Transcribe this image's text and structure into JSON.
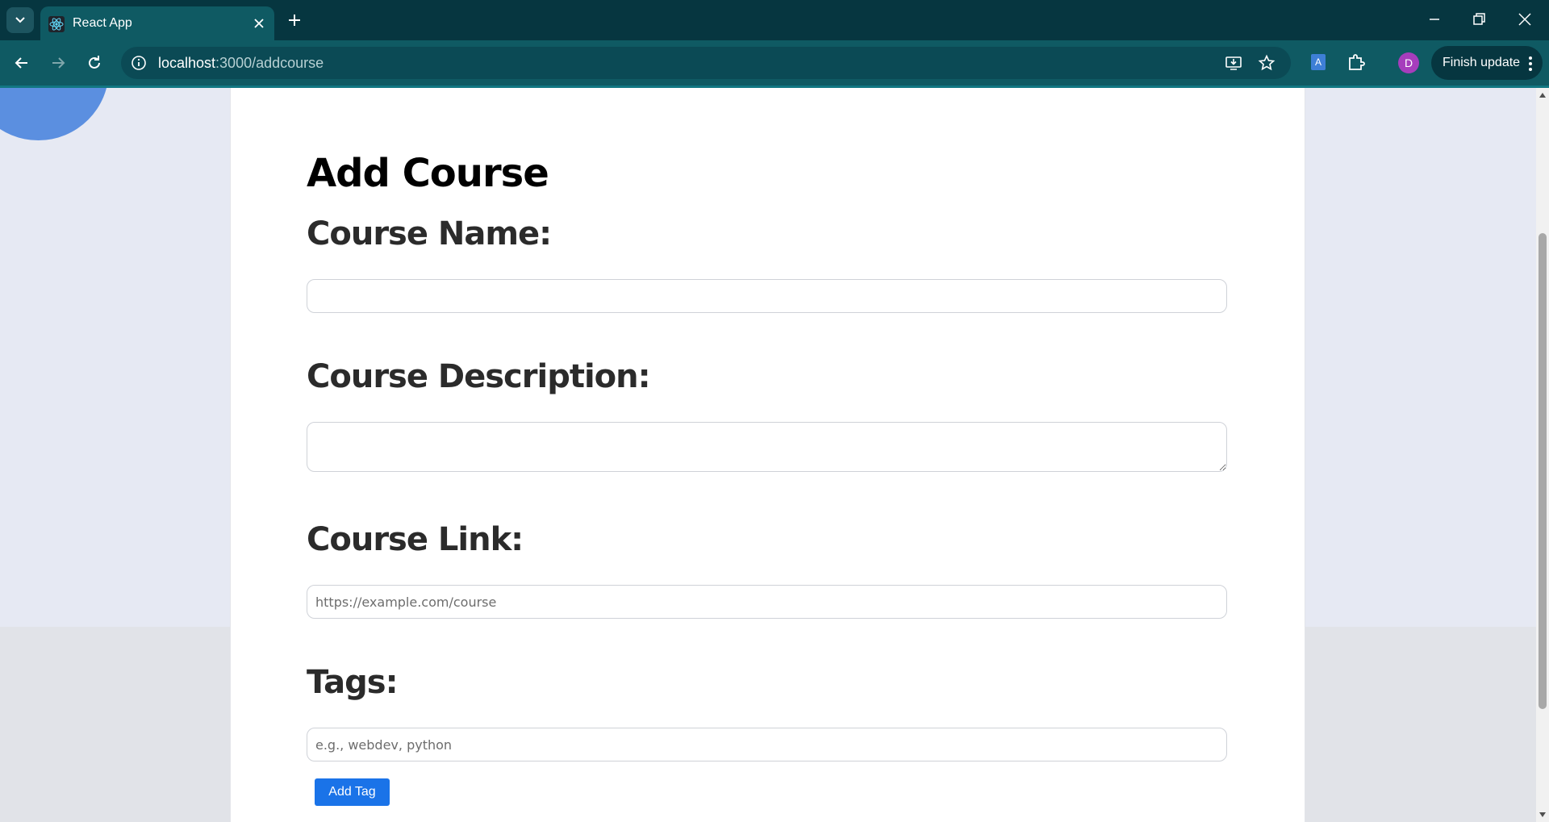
{
  "browser": {
    "tab_title": "React App",
    "url_host": "localhost",
    "url_path": ":3000/addcourse",
    "profile_initial": "D",
    "update_button_label": "Finish update",
    "accent_color": "#0f5a63"
  },
  "page": {
    "title": "Add Course",
    "course_name_label": "Course Name:",
    "course_name_value": "",
    "course_description_label": "Course Description:",
    "course_description_value": "",
    "course_link_label": "Course Link:",
    "course_link_placeholder": "https://example.com/course",
    "tags_label": "Tags:",
    "tags_placeholder": "e.g., webdev, python",
    "add_tag_button": "Add Tag",
    "button_color": "#1a73e8"
  }
}
